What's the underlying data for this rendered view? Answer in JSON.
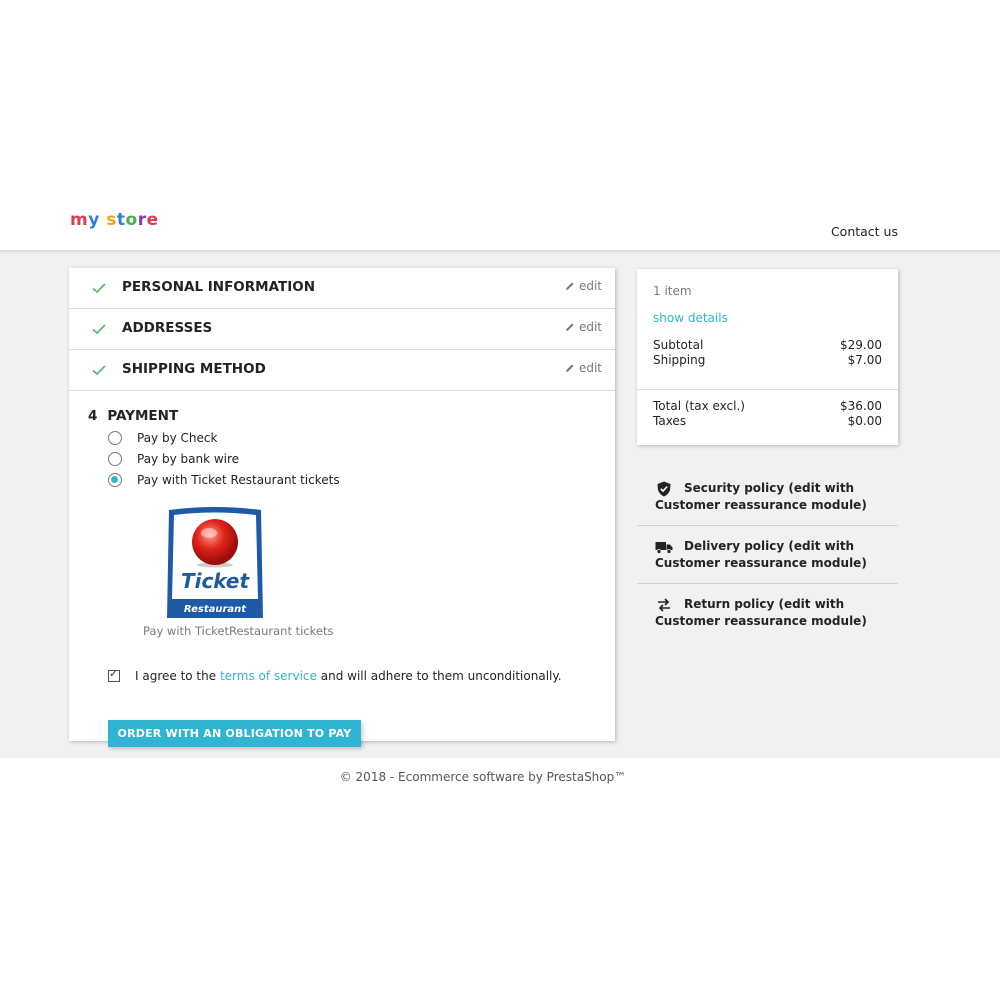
{
  "header": {
    "logo_text": "my store",
    "contact_label": "Contact us"
  },
  "checkout": {
    "steps": [
      {
        "label": "PERSONAL INFORMATION",
        "edit": "edit"
      },
      {
        "label": "ADDRESSES",
        "edit": "edit"
      },
      {
        "label": "SHIPPING METHOD",
        "edit": "edit"
      }
    ],
    "payment": {
      "number": "4",
      "title": "PAYMENT",
      "options": [
        {
          "label": "Pay by Check",
          "selected": false
        },
        {
          "label": "Pay by bank wire",
          "selected": false
        },
        {
          "label": "Pay with Ticket Restaurant tickets",
          "selected": true
        }
      ],
      "logo_text_1": "Ticket",
      "logo_text_2": "Restaurant",
      "logo_caption": "Pay with TicketRestaurant tickets"
    },
    "terms": {
      "prefix": "I agree to the",
      "link": "terms of service",
      "suffix": "and will adhere to them unconditionally."
    },
    "order_button": "ORDER WITH AN OBLIGATION TO PAY"
  },
  "summary": {
    "items_count": "1 item",
    "show_details": "show details",
    "subtotal_label": "Subtotal",
    "subtotal_value": "$29.00",
    "shipping_label": "Shipping",
    "shipping_value": "$7.00",
    "total_label": "Total (tax excl.)",
    "total_value": "$36.00",
    "taxes_label": "Taxes",
    "taxes_value": "$0.00"
  },
  "reassurance": [
    {
      "line1": "Security policy (edit with",
      "line2": "Customer reassurance module)",
      "icon": "shield-icon"
    },
    {
      "line1": "Delivery policy (edit with",
      "line2": "Customer reassurance module)",
      "icon": "truck-icon"
    },
    {
      "line1": "Return policy (edit with",
      "line2": "Customer reassurance module)",
      "icon": "exchange-icon"
    }
  ],
  "footer": {
    "copyright": "© 2018 - Ecommerce software by PrestaShop™"
  },
  "colors": {
    "accent": "#2fb5d2",
    "check": "#4cbb6c",
    "background": "#f1f1f1"
  }
}
